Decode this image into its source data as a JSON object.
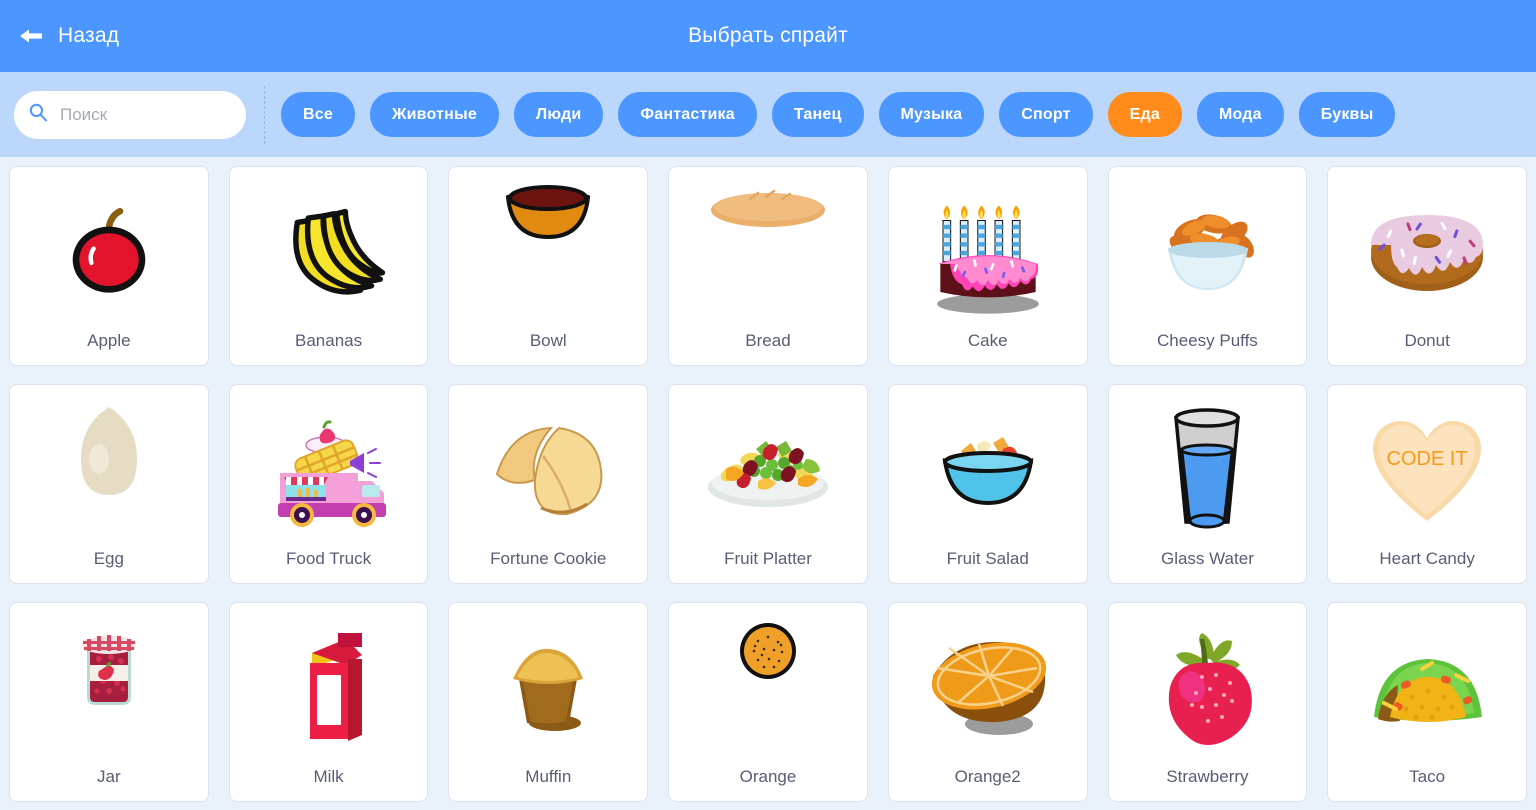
{
  "header": {
    "back_label": "Назад",
    "back_icon": "arrow-left-icon",
    "title": "Выбрать спрайт",
    "bg_color": "#4c97ff"
  },
  "search": {
    "icon": "search-icon",
    "placeholder": "Поиск",
    "value": ""
  },
  "filter_bar": {
    "bg_color": "#bcd7fc",
    "active_color": "#ff8c1a",
    "tag_color": "#4c97ff"
  },
  "categories": [
    {
      "label": "Все",
      "active": false
    },
    {
      "label": "Животные",
      "active": false
    },
    {
      "label": "Люди",
      "active": false
    },
    {
      "label": "Фантастика",
      "active": false
    },
    {
      "label": "Танец",
      "active": false
    },
    {
      "label": "Музыка",
      "active": false
    },
    {
      "label": "Спорт",
      "active": false
    },
    {
      "label": "Еда",
      "active": true
    },
    {
      "label": "Мода",
      "active": false
    },
    {
      "label": "Буквы",
      "active": false
    }
  ],
  "sprites": [
    {
      "label": "Apple",
      "icon": "apple-icon"
    },
    {
      "label": "Bananas",
      "icon": "bananas-icon"
    },
    {
      "label": "Bowl",
      "icon": "bowl-icon"
    },
    {
      "label": "Bread",
      "icon": "bread-icon"
    },
    {
      "label": "Cake",
      "icon": "cake-icon"
    },
    {
      "label": "Cheesy Puffs",
      "icon": "cheesy-puffs-icon"
    },
    {
      "label": "Donut",
      "icon": "donut-icon"
    },
    {
      "label": "Egg",
      "icon": "egg-icon"
    },
    {
      "label": "Food Truck",
      "icon": "food-truck-icon"
    },
    {
      "label": "Fortune Cookie",
      "icon": "fortune-cookie-icon"
    },
    {
      "label": "Fruit Platter",
      "icon": "fruit-platter-icon"
    },
    {
      "label": "Fruit Salad",
      "icon": "fruit-salad-icon"
    },
    {
      "label": "Glass Water",
      "icon": "glass-water-icon"
    },
    {
      "label": "Heart Candy",
      "icon": "heart-candy-icon"
    },
    {
      "label": "Jar",
      "icon": "jar-icon"
    },
    {
      "label": "Milk",
      "icon": "milk-icon"
    },
    {
      "label": "Muffin",
      "icon": "muffin-icon"
    },
    {
      "label": "Orange",
      "icon": "orange-icon"
    },
    {
      "label": "Orange2",
      "icon": "orange2-icon"
    },
    {
      "label": "Strawberry",
      "icon": "strawberry-icon"
    },
    {
      "label": "Taco",
      "icon": "taco-icon"
    }
  ],
  "heart_candy_text": "CODE IT"
}
